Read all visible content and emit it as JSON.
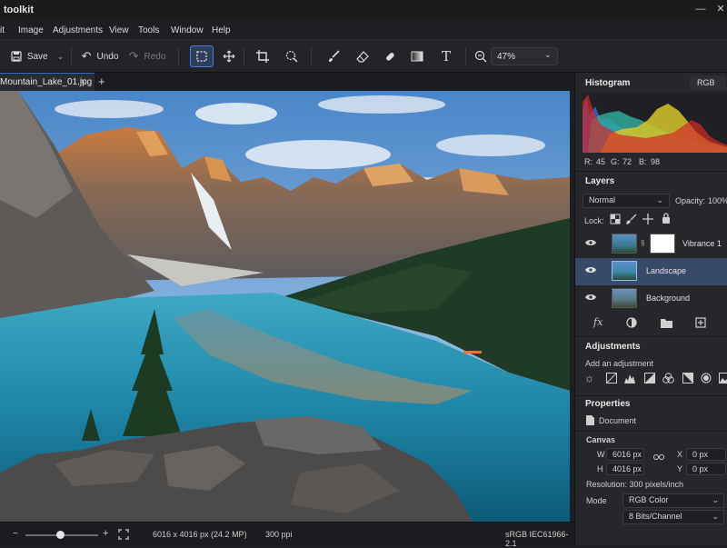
{
  "app": {
    "title": "toolkit"
  },
  "menu": {
    "items": [
      "it",
      "Image",
      "Adjustments",
      "View",
      "Tools",
      "Window",
      "Help"
    ]
  },
  "toolbar": {
    "save_label": "Save",
    "undo_label": "Undo",
    "redo_label": "Redo",
    "zoom": "47%"
  },
  "tabs": {
    "active_label": "Mountain_Lake_01.jpg",
    "close": "×",
    "add": "+"
  },
  "status": {
    "dimensions": "6016 x 4016 px (24.2 MP)",
    "ppi": "300 ppi",
    "profile": "sRGB IEC61966-2.1"
  },
  "histogram": {
    "title": "Histogram",
    "channel": "RGB",
    "r_label": "R:",
    "r": "45",
    "g_label": "G:",
    "g": "72",
    "b_label": "B:",
    "b": "98"
  },
  "layers": {
    "title": "Layers",
    "blend_mode": "Normal",
    "opacity_label": "Opacity:",
    "opacity": "100%",
    "lock_label": "Lock:",
    "items": [
      {
        "name": "Vibrance 1"
      },
      {
        "name": "Landscape"
      },
      {
        "name": "Background"
      }
    ]
  },
  "adjustments": {
    "title": "Adjustments",
    "hint": "Add an adjustment"
  },
  "properties": {
    "title": "Properties",
    "document_label": "Document",
    "canvas_label": "Canvas",
    "w_label": "W",
    "w": "6016 px",
    "h_label": "H",
    "h": "4016 px",
    "x_label": "X",
    "x": "0 px",
    "y_label": "Y",
    "y": "0 px",
    "resolution": "Resolution:  300 pixels/inch",
    "mode_label": "Mode",
    "mode": "RGB Color",
    "bits": "8 Bits/Channel"
  },
  "colors": {
    "accent": "#4a7adb",
    "panel": "#26272b",
    "selected_layer": "#384a6a"
  }
}
